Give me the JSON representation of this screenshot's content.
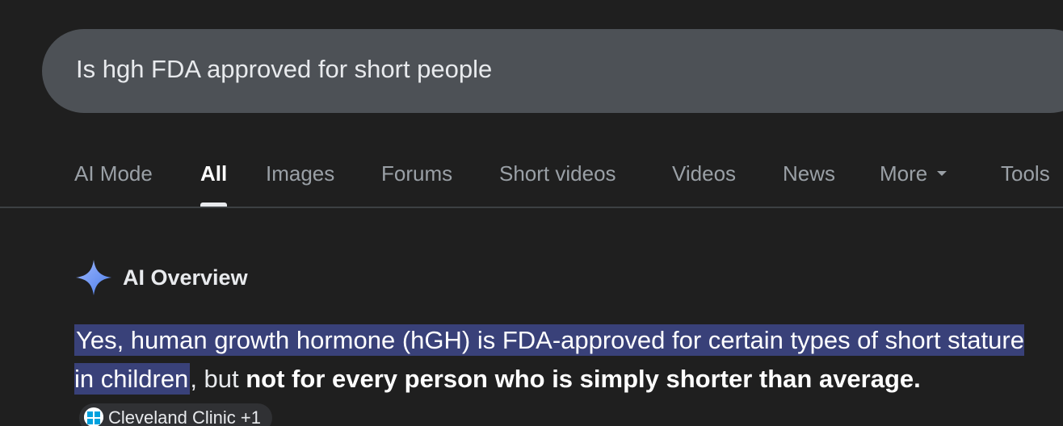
{
  "search": {
    "query": "Is hgh FDA approved for short people"
  },
  "tabs": [
    {
      "label": "AI Mode"
    },
    {
      "label": "All",
      "active": true
    },
    {
      "label": "Images"
    },
    {
      "label": "Forums"
    },
    {
      "label": "Short videos"
    },
    {
      "label": "Videos"
    },
    {
      "label": "News"
    },
    {
      "label": "More"
    },
    {
      "label": "Tools"
    }
  ],
  "ai_overview": {
    "title": "AI Overview",
    "answer": {
      "highlighted": "Yes, human growth hormone (hGH) is FDA-approved for certain types of short stature in children",
      "normal": ", but ",
      "bold": "not for every person who is simply shorter than average",
      "end": "."
    },
    "source_chip": "Cleveland Clinic +1"
  },
  "colors": {
    "background": "#1f1f1f",
    "search_bar": "#4d5156",
    "highlight": "#394179",
    "ai_sparkle": "#7fa3f5"
  },
  "icons": {
    "ai_overview": "sparkle-icon",
    "more": "caret-down-icon",
    "source": "cleveland-clinic-icon"
  }
}
